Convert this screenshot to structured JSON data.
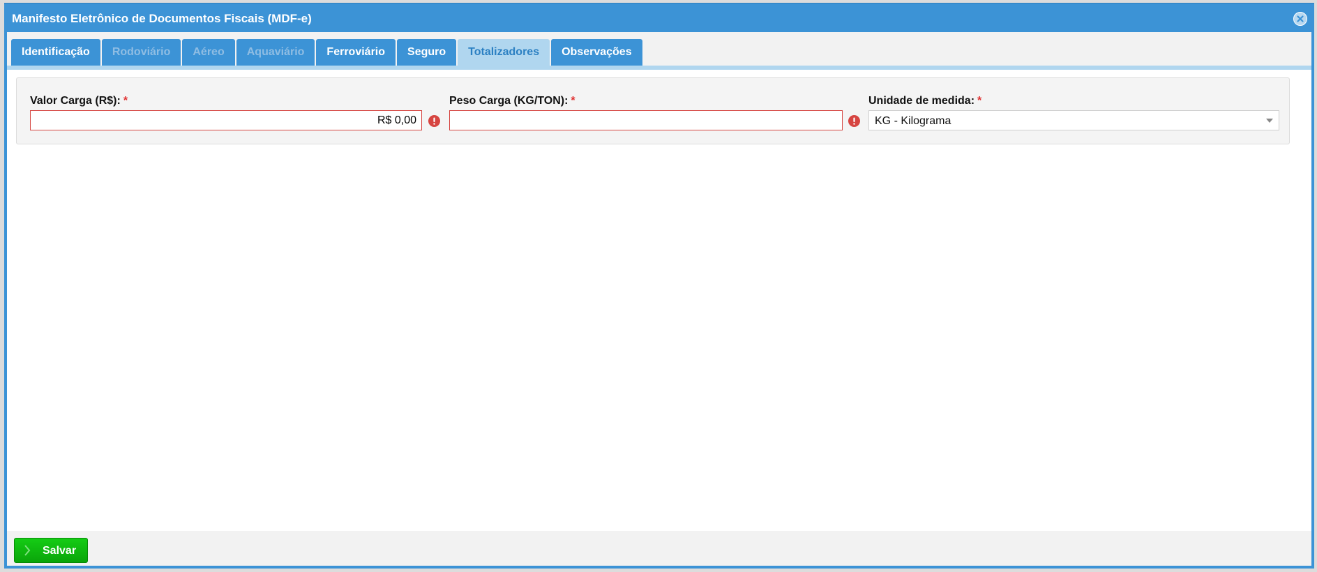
{
  "window": {
    "title": "Manifesto Eletrônico de Documentos Fiscais (MDF-e)"
  },
  "tabs": [
    {
      "label": "Identificação",
      "state": "enabled"
    },
    {
      "label": "Rodoviário",
      "state": "disabled"
    },
    {
      "label": "Aéreo",
      "state": "disabled"
    },
    {
      "label": "Aquaviário",
      "state": "disabled"
    },
    {
      "label": "Ferroviário",
      "state": "enabled"
    },
    {
      "label": "Seguro",
      "state": "enabled"
    },
    {
      "label": "Totalizadores",
      "state": "active"
    },
    {
      "label": "Observações",
      "state": "enabled"
    }
  ],
  "form": {
    "valor_carga": {
      "label": "Valor Carga (R$):",
      "required_mark": "*",
      "value": "R$ 0,00",
      "has_error": true
    },
    "peso_carga": {
      "label": "Peso Carga (KG/TON):",
      "required_mark": "*",
      "value": "",
      "has_error": true
    },
    "unidade_medida": {
      "label": "Unidade de medida:",
      "required_mark": "*",
      "selected": "KG - Kilograma"
    }
  },
  "footer": {
    "save_label": "Salvar"
  },
  "colors": {
    "header": "#3c93d6",
    "tab_active_bg": "#b0d6ef",
    "error": "#d64541",
    "save_button": "#0fb80f"
  },
  "icons": {
    "close": "close-circle-icon",
    "error": "exclamation-circle-icon",
    "save": "chevron-right-icon",
    "dropdown": "chevron-down-icon"
  }
}
